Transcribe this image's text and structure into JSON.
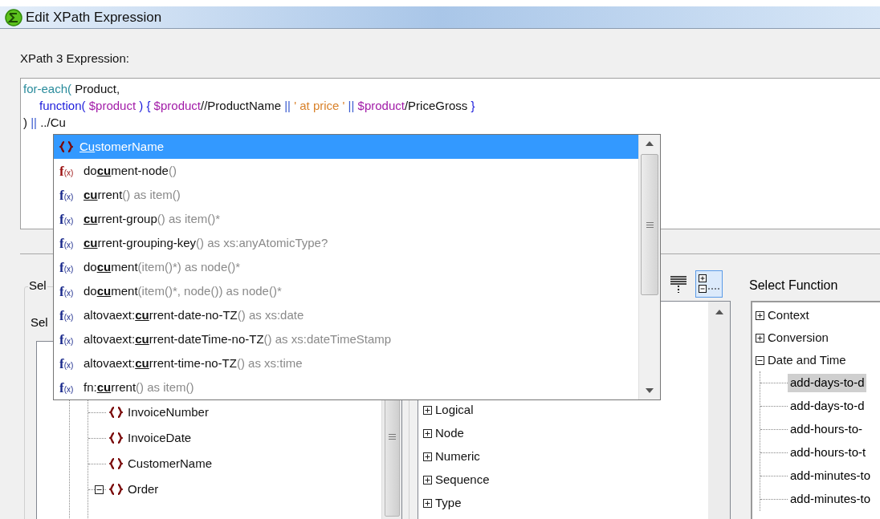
{
  "window": {
    "title": "Edit XPath Expression"
  },
  "expression": {
    "label": "XPath 3 Expression:",
    "lines": [
      {
        "indent": false,
        "tokens": [
          {
            "kind": "keyword",
            "text": "for-each("
          },
          {
            "kind": "plain",
            "text": " Product,"
          }
        ]
      },
      {
        "indent": true,
        "tokens": [
          {
            "kind": "function",
            "text": "function("
          },
          {
            "kind": "variable",
            "text": " $product"
          },
          {
            "kind": "function",
            "text": " ) { "
          },
          {
            "kind": "variable",
            "text": "$product"
          },
          {
            "kind": "plain",
            "text": "//ProductName "
          },
          {
            "kind": "operator",
            "text": "||"
          },
          {
            "kind": "string",
            "text": " ' at price ' "
          },
          {
            "kind": "operator",
            "text": "||"
          },
          {
            "kind": "variable",
            "text": " $product"
          },
          {
            "kind": "plain",
            "text": "/PriceGross "
          },
          {
            "kind": "function",
            "text": "}"
          }
        ]
      },
      {
        "indent": false,
        "tokens": [
          {
            "kind": "plain",
            "text": ") "
          },
          {
            "kind": "operator",
            "text": "||"
          },
          {
            "kind": "plain",
            "text": " ../Cu"
          }
        ]
      }
    ]
  },
  "autocomplete": {
    "items": [
      {
        "kind": "element",
        "match": "Cu",
        "rest": "stomerName",
        "selected": true
      },
      {
        "kind": "function",
        "icon_letter": "f",
        "icon_arg": "(x)",
        "color": "#9b1010",
        "prefix": "do",
        "match": "cu",
        "rest": "ment-node",
        "signature": "()",
        "selected": false
      },
      {
        "kind": "function",
        "icon_letter": "f",
        "icon_arg": "(x)",
        "color": "#1a2a8c",
        "match": "cu",
        "rest": "rrent",
        "signature": "() as item()",
        "selected": false
      },
      {
        "kind": "function",
        "icon_letter": "f",
        "icon_arg": "(x)",
        "color": "#1a2a8c",
        "match": "cu",
        "rest": "rrent-group",
        "signature": "() as item()*",
        "selected": false
      },
      {
        "kind": "function",
        "icon_letter": "f",
        "icon_arg": "(x)",
        "color": "#1a2a8c",
        "match": "cu",
        "rest": "rrent-grouping-key",
        "signature": "() as xs:anyAtomicType?",
        "selected": false
      },
      {
        "kind": "function",
        "icon_letter": "f",
        "icon_arg": "(x)",
        "color": "#1a2a8c",
        "prefix": "do",
        "match": "cu",
        "rest": "ment",
        "signature": "(item()*) as node()*",
        "selected": false
      },
      {
        "kind": "function",
        "icon_letter": "f",
        "icon_arg": "(x)",
        "color": "#1a2a8c",
        "prefix": "do",
        "match": "cu",
        "rest": "ment",
        "signature": "(item()*, node()) as node()*",
        "selected": false
      },
      {
        "kind": "function",
        "icon_letter": "f",
        "icon_arg": "(x)",
        "color": "#1a2a8c",
        "prefix": "altovaext:",
        "match": "cu",
        "rest": "rrent-date-no-TZ",
        "signature": "() as xs:date",
        "selected": false
      },
      {
        "kind": "function",
        "icon_letter": "f",
        "icon_arg": "(x)",
        "color": "#1a2a8c",
        "prefix": "altovaext:",
        "match": "cu",
        "rest": "rrent-dateTime-no-TZ",
        "signature": "() as xs:dateTimeStamp",
        "selected": false
      },
      {
        "kind": "function",
        "icon_letter": "f",
        "icon_arg": "(x)",
        "color": "#1a2a8c",
        "prefix": "altovaext:",
        "match": "cu",
        "rest": "rrent-time-no-TZ",
        "signature": "() as xs:time",
        "selected": false
      },
      {
        "kind": "function",
        "icon_letter": "f",
        "icon_arg": "(x)",
        "color": "#1a2a8c",
        "prefix": "fn:",
        "match": "cu",
        "rest": "rrent",
        "signature": "() as item()",
        "selected": false
      }
    ]
  },
  "left_panel": {
    "group_label": "Sel",
    "select_label": "Sel",
    "tree": [
      {
        "label": "InvoiceNumber",
        "expanded": false
      },
      {
        "label": "InvoiceDate",
        "expanded": false
      },
      {
        "label": "CustomerName",
        "expanded": false
      },
      {
        "label": "Order",
        "expanded": true
      }
    ]
  },
  "middle_panel": {
    "view_buttons": [
      {
        "kind": "flat",
        "selected": false
      },
      {
        "kind": "tree",
        "selected": true
      }
    ],
    "tree": [
      {
        "label": "Logical",
        "expanded": false
      },
      {
        "label": "Node",
        "expanded": false
      },
      {
        "label": "Numeric",
        "expanded": false
      },
      {
        "label": "Sequence",
        "expanded": false
      },
      {
        "label": "Type",
        "expanded": false
      }
    ]
  },
  "right_panel": {
    "label": "Select Function",
    "tree": [
      {
        "label": "Context",
        "expanded": false
      },
      {
        "label": "Conversion",
        "expanded": false
      },
      {
        "label": "Date and Time",
        "expanded": true,
        "children": [
          {
            "label": "add-days-to-d",
            "selected": true
          },
          {
            "label": "add-days-to-d",
            "selected": false
          },
          {
            "label": "add-hours-to-",
            "selected": false
          },
          {
            "label": "add-hours-to-t",
            "selected": false
          },
          {
            "label": "add-minutes-to",
            "selected": false
          },
          {
            "label": "add-minutes-to",
            "selected": false
          }
        ]
      }
    ]
  }
}
